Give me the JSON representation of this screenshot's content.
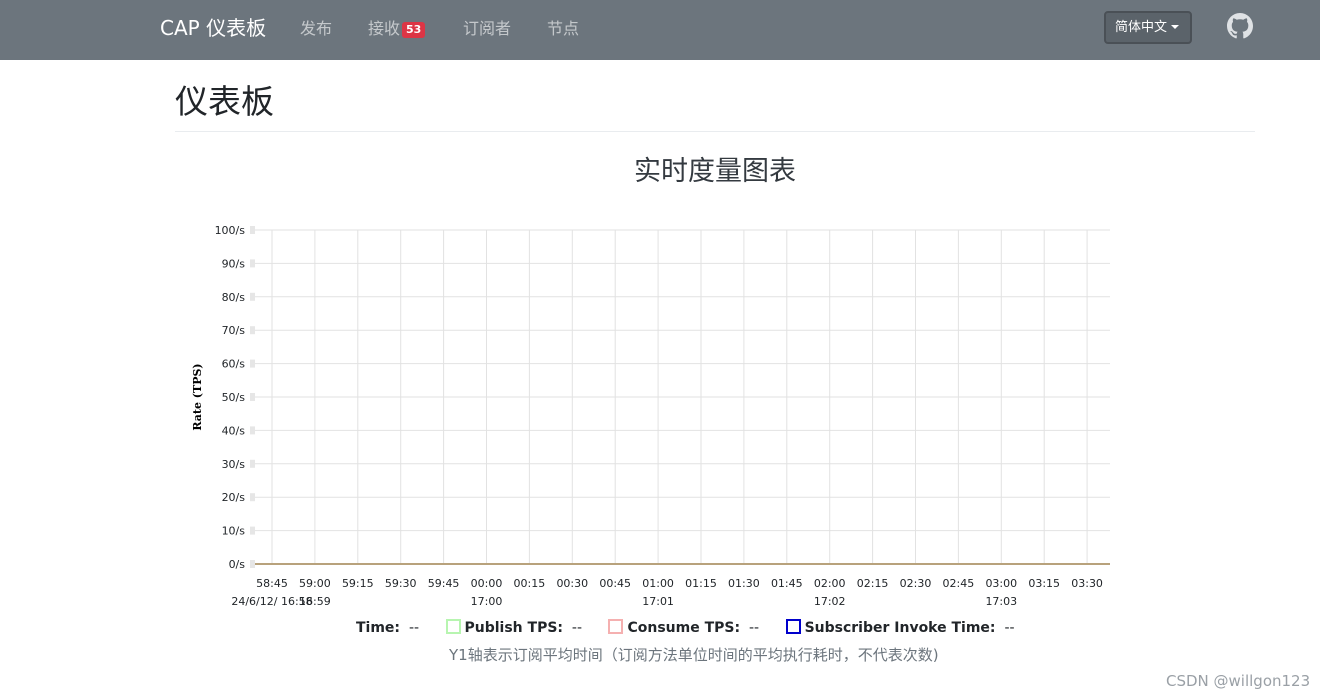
{
  "navbar": {
    "brand": "CAP 仪表板",
    "links": [
      {
        "label": "发布"
      },
      {
        "label": "接收",
        "badge": "53"
      },
      {
        "label": "订阅者"
      },
      {
        "label": "节点"
      }
    ],
    "language": "简体中文",
    "github_icon": "github-icon"
  },
  "page": {
    "title": "仪表板"
  },
  "chart": {
    "heading": "实时度量图表"
  },
  "chart_data": {
    "type": "line",
    "ylabel": "Rate (TPS)",
    "ylim": [
      0,
      100
    ],
    "y_ticks": [
      "0/s",
      "10/s",
      "20/s",
      "30/s",
      "40/s",
      "50/s",
      "60/s",
      "70/s",
      "80/s",
      "90/s",
      "100/s"
    ],
    "x_ticks": [
      "58:45",
      "59:00",
      "59:15",
      "59:30",
      "59:45",
      "00:00",
      "00:15",
      "00:30",
      "00:45",
      "01:00",
      "01:15",
      "01:30",
      "01:45",
      "02:00",
      "02:15",
      "02:30",
      "02:45",
      "03:00",
      "03:15",
      "03:30"
    ],
    "x_secondary_labels": [
      {
        "tick": "58:45",
        "label": "24/6/12/ 16:58"
      },
      {
        "tick": "59:00",
        "label": "16:59"
      },
      {
        "tick": "00:00",
        "label": "17:00"
      },
      {
        "tick": "01:00",
        "label": "17:01"
      },
      {
        "tick": "02:00",
        "label": "17:02"
      },
      {
        "tick": "03:00",
        "label": "17:03"
      }
    ],
    "grid": true,
    "series": [
      {
        "name": "Publish TPS",
        "color": "#b7f5b0",
        "values": [
          0,
          0,
          0,
          0,
          0,
          0,
          0,
          0,
          0,
          0,
          0,
          0,
          0,
          0,
          0,
          0,
          0,
          0,
          0,
          0
        ]
      },
      {
        "name": "Consume TPS",
        "color": "#f5b0b0",
        "values": [
          0,
          0,
          0,
          0,
          0,
          0,
          0,
          0,
          0,
          0,
          0,
          0,
          0,
          0,
          0,
          0,
          0,
          0,
          0,
          0
        ]
      },
      {
        "name": "Subscriber Invoke Time",
        "color": "#0000cc",
        "values": [
          0,
          0,
          0,
          0,
          0,
          0,
          0,
          0,
          0,
          0,
          0,
          0,
          0,
          0,
          0,
          0,
          0,
          0,
          0,
          0
        ]
      }
    ],
    "baseline_color": "#b8a27c"
  },
  "legend": {
    "time_label": "Time:",
    "time_value": "--",
    "publish_label": "Publish TPS:",
    "publish_value": "--",
    "consume_label": "Consume TPS:",
    "consume_value": "--",
    "invoke_label": "Subscriber Invoke Time:",
    "invoke_value": "--"
  },
  "note": "Y1轴表示订阅平均时间（订阅方法单位时间的平均执行耗时，不代表次数)",
  "watermark": "CSDN @willgon123"
}
